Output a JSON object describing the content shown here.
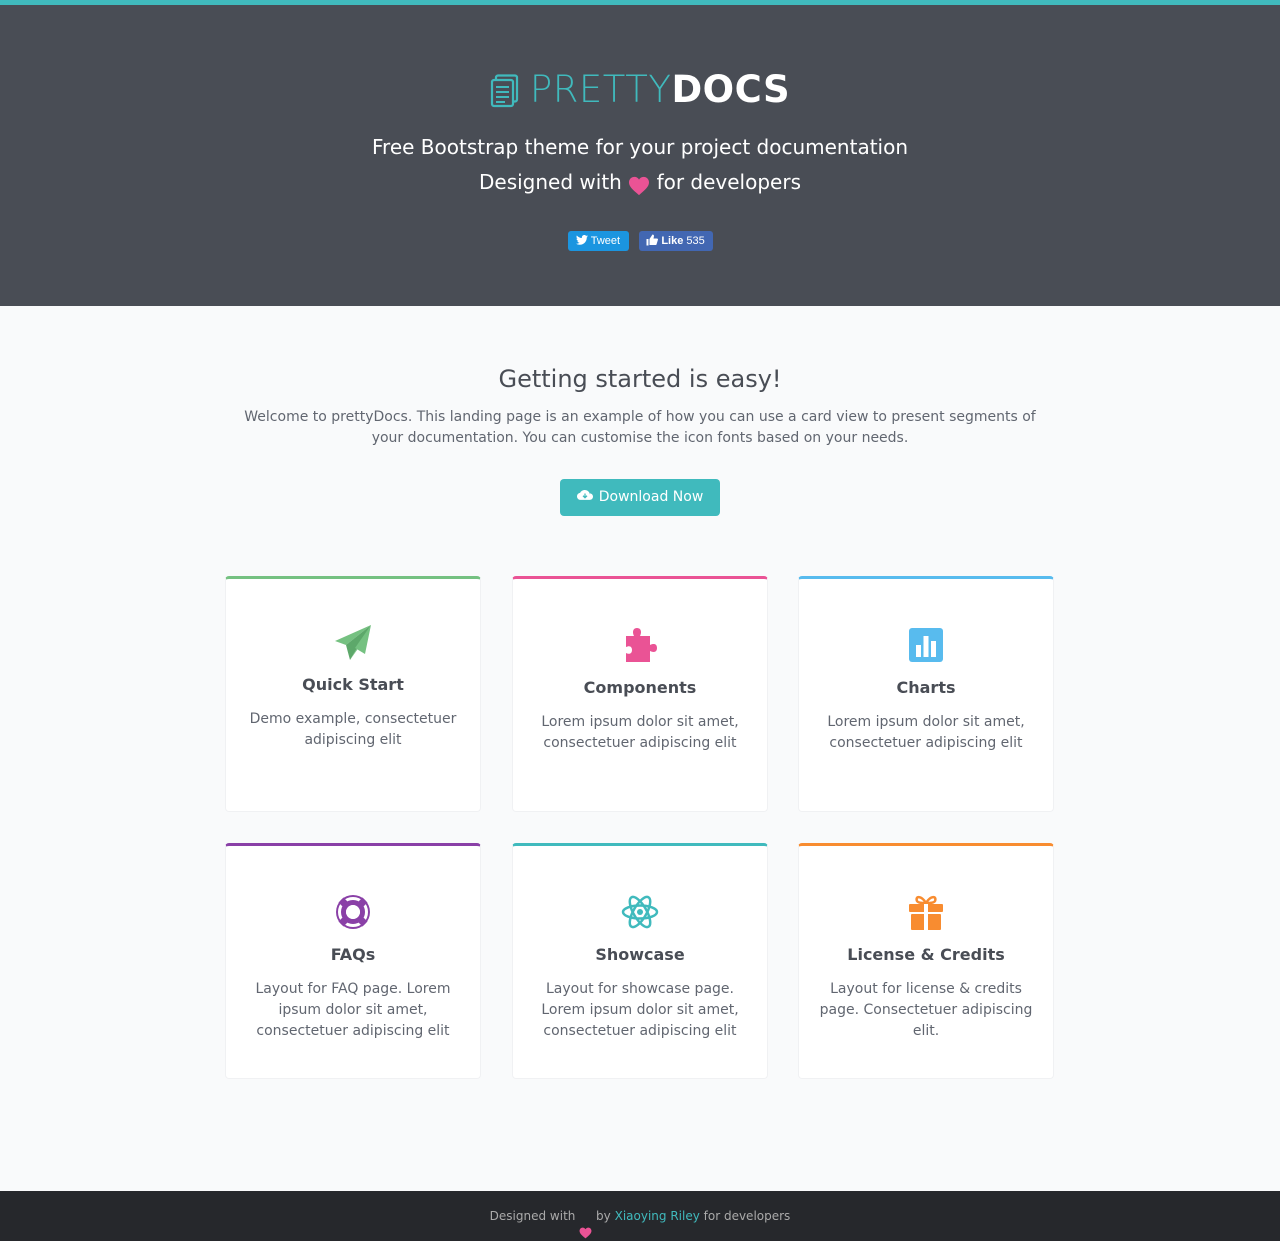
{
  "header": {
    "brand_pretty": "PRETTY",
    "brand_docs": "DOCS",
    "tagline_line1": "Free Bootstrap theme for your project documentation",
    "tagline_line2_before": "Designed with",
    "tagline_line2_after": "for developers",
    "tweet_label": "Tweet",
    "like_label": "Like",
    "like_count": "535"
  },
  "intro": {
    "title": "Getting started is easy!",
    "text": "Welcome to prettyDocs. This landing page is an example of how you can use a card view to present segments of your documentation. You can customise the icon fonts based on your needs.",
    "download_label": "Download Now"
  },
  "cards": [
    {
      "title": "Quick Start",
      "desc": "Demo example, consectetuer adipiscing elit",
      "color": "#75c181",
      "icon": "paper-plane-icon"
    },
    {
      "title": "Components",
      "desc": "Lorem ipsum dolor sit amet, consectetuer adipiscing elit",
      "color": "#ea5395",
      "icon": "puzzle-icon"
    },
    {
      "title": "Charts",
      "desc": "Lorem ipsum dolor sit amet, consectetuer adipiscing elit",
      "color": "#58bbee",
      "icon": "bar-chart-icon"
    },
    {
      "title": "FAQs",
      "desc": "Layout for FAQ page. Lorem ipsum dolor sit amet, consectetuer adipiscing elit",
      "color": "#8a40a7",
      "icon": "life-ring-icon"
    },
    {
      "title": "Showcase",
      "desc": "Layout for showcase page. Lorem ipsum dolor sit amet, consectetuer adipiscing elit",
      "color": "#40babd",
      "icon": "atom-icon"
    },
    {
      "title": "License & Credits",
      "desc": "Layout for license & credits page. Consectetuer adipiscing elit.",
      "color": "#f88c30",
      "icon": "gift-icon"
    }
  ],
  "footer": {
    "before": "Designed with",
    "by": "by",
    "author": "Xiaoying Riley",
    "after": "for developers"
  },
  "colors": {
    "accent": "#40babd",
    "header_bg": "#494d55",
    "footer_bg": "#26282c",
    "heart": "#ea5395"
  }
}
